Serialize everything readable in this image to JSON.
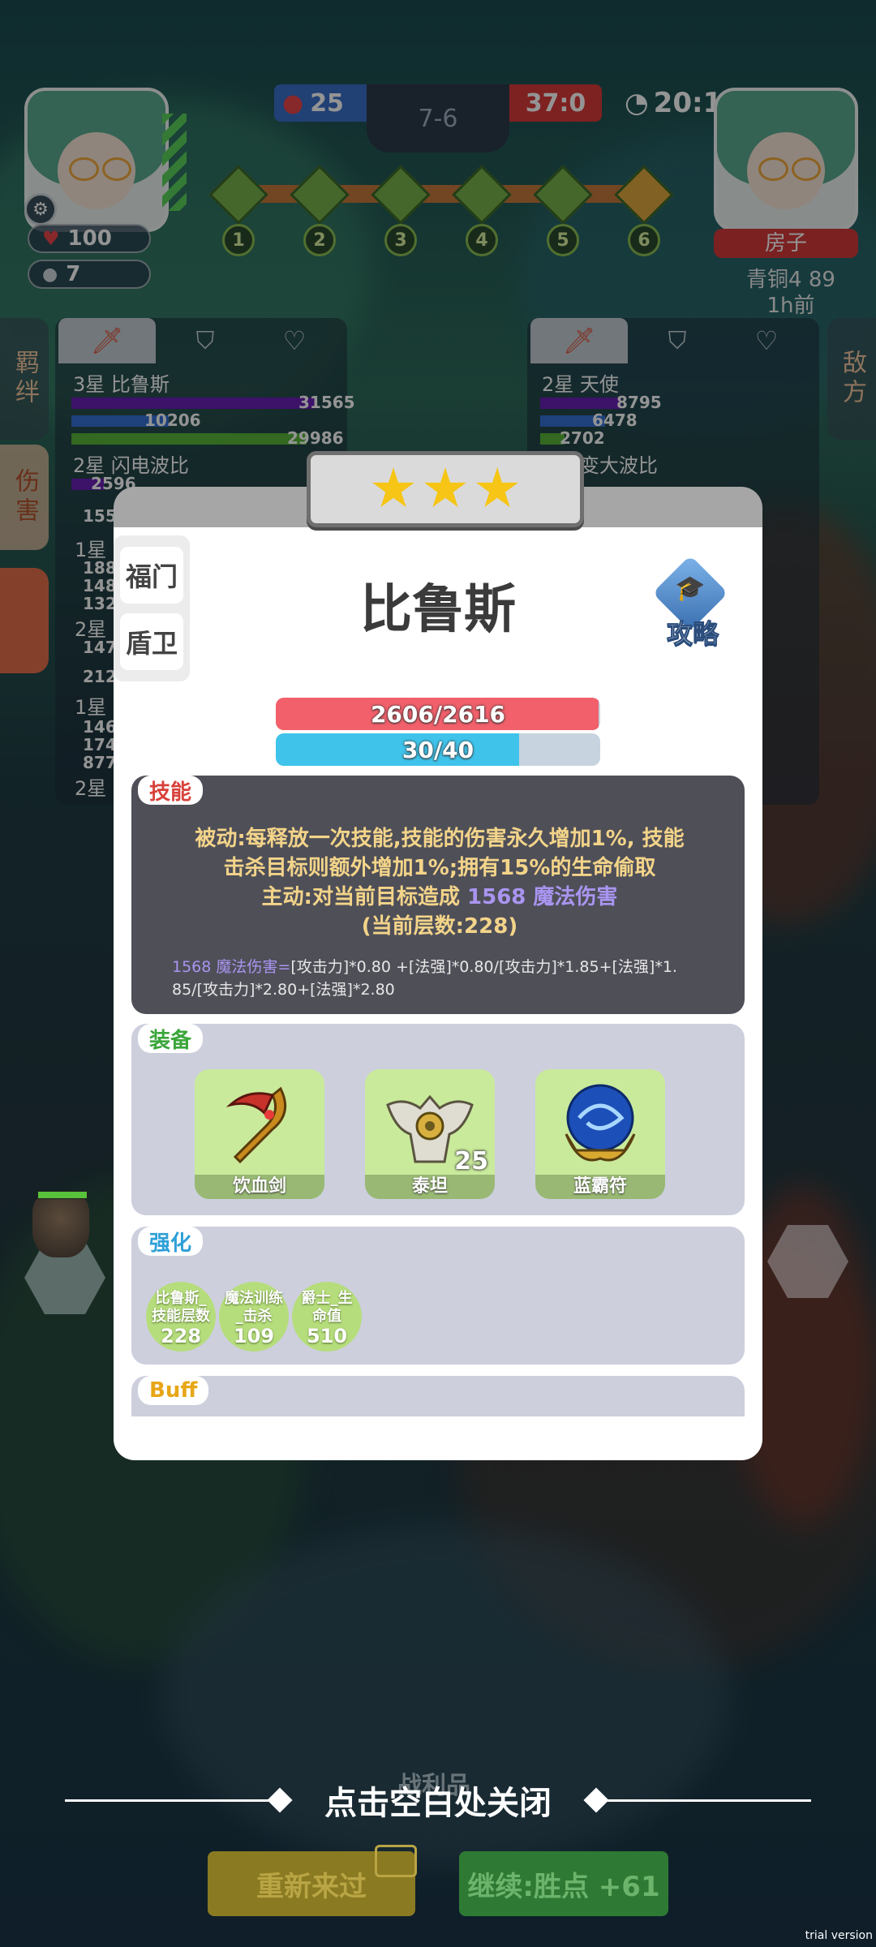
{
  "hud": {
    "player_hearts": "100",
    "player_coins": "7",
    "fire_score": "25",
    "round": "7-6",
    "match_score": "37:0",
    "timer": "20:1",
    "stage_nodes": [
      "1",
      "2",
      "3",
      "4",
      "5",
      "6"
    ],
    "opponent_name": "房子",
    "opponent_rank": "青铜4 89",
    "opponent_time": "1h前"
  },
  "left_panel": {
    "side_tabs": [
      "羁绊",
      "伤害"
    ],
    "units": [
      {
        "name": "3星 比鲁斯",
        "v1": "31565",
        "v2": "10206",
        "v3": "29986"
      },
      {
        "name": "2星 闪电波比",
        "v1": "2596",
        "v2": "155",
        "v3": ""
      }
    ],
    "stars_rows": [
      "1星",
      "2星",
      "1星",
      "2星"
    ],
    "partial_nums": [
      "188",
      "148",
      "132",
      "147",
      "212",
      "146",
      "174",
      "877"
    ]
  },
  "right_panel": {
    "side_tab": "敌方",
    "units": [
      {
        "name": "2星 天使",
        "v1": "8795",
        "v2": "6478",
        "v3": "2702"
      },
      {
        "name": "2星 变大波比",
        "v1": "",
        "v2": "",
        "v3": ""
      }
    ]
  },
  "modal": {
    "stars": 3,
    "tabs": [
      "福门",
      "盾卫"
    ],
    "hero_name": "比鲁斯",
    "guide_label": "攻略",
    "hp": {
      "text": "2606/2616",
      "current": 2606,
      "max": 2616
    },
    "mana": {
      "text": "30/40",
      "current": 30,
      "max": 40
    },
    "skill": {
      "tag": "技能",
      "passive_line1": "被动:每释放一次技能,技能的伤害永久增加1%, 技能",
      "passive_line2": "击杀目标则额外增加1%;拥有15%的生命偷取",
      "active_prefix": "主动:对当前目标造成",
      "active_value": "1568 魔法伤害",
      "stacks": "(当前层数:228)",
      "formula_head": "1568 魔法伤害=",
      "formula_body1": "[攻击力]*0.80 +[法强]*0.80/[攻击力]*1.85+[法强]*1.",
      "formula_body2": "85/[攻击力]*2.80+[法强]*2.80"
    },
    "equipment": {
      "tag": "装备",
      "items": [
        {
          "name": "饮血剑",
          "icon": "scythe-icon",
          "badge": ""
        },
        {
          "name": "泰坦",
          "icon": "armor-icon",
          "badge": "25"
        },
        {
          "name": "蓝霸符",
          "icon": "orb-icon",
          "badge": ""
        }
      ]
    },
    "enhance": {
      "tag": "强化",
      "chips": [
        {
          "line1": "比鲁斯_",
          "line2": "技能层数",
          "value": "228"
        },
        {
          "line1": "魔法训练",
          "line2": "_击杀",
          "value": "109"
        },
        {
          "line1": "爵士_生",
          "line2": "命值",
          "value": "510"
        }
      ]
    },
    "buff": {
      "tag": "Buff"
    }
  },
  "footer": {
    "loot_label": "战利品",
    "close_hint": "点击空白处关闭",
    "retry_label": "重新来过",
    "continue_label": "继续:胜点 +61",
    "watermark": "trial version"
  },
  "colors": {
    "hp": "#f2606b",
    "mana": "#3fc3ea",
    "skill_text": "#f3d489",
    "skill_value": "#a995f0",
    "equip_tag": "#3aa63a",
    "enhance_tag": "#2f9fd8",
    "buff_tag": "#e7a617",
    "skill_tag": "#d8413b"
  }
}
